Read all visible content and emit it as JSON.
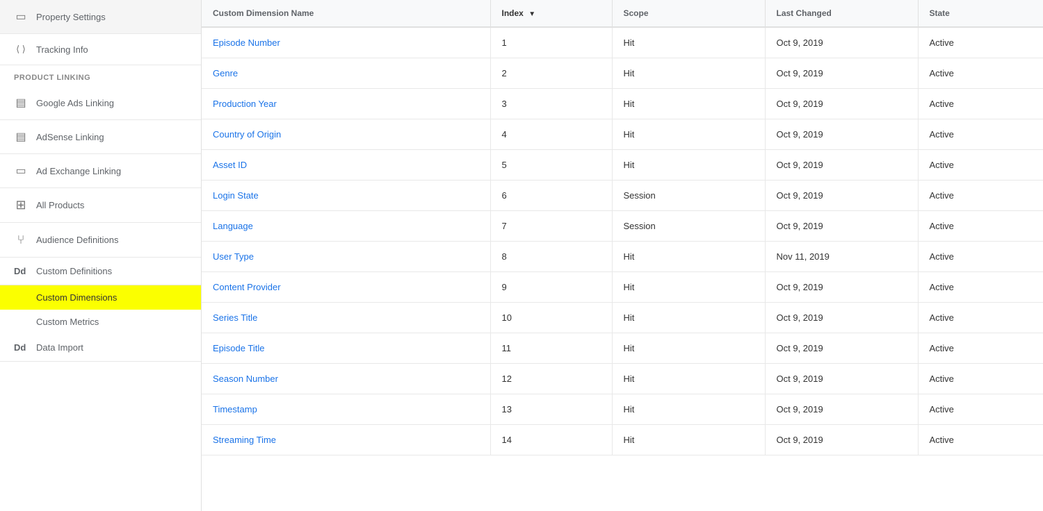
{
  "sidebar": {
    "items": [
      {
        "id": "property-settings",
        "label": "Property Settings",
        "icon": "▭",
        "type": "item"
      },
      {
        "id": "tracking-info",
        "label": "Tracking Info",
        "icon": "⟨⟩",
        "type": "item"
      },
      {
        "id": "product-linking-section",
        "label": "PRODUCT LINKING",
        "type": "section"
      },
      {
        "id": "google-ads-linking",
        "label": "Google Ads Linking",
        "icon": "▤",
        "type": "item"
      },
      {
        "id": "adsense-linking",
        "label": "AdSense Linking",
        "icon": "▤",
        "type": "item"
      },
      {
        "id": "ad-exchange-linking",
        "label": "Ad Exchange Linking",
        "icon": "▭",
        "type": "item"
      },
      {
        "id": "all-products",
        "label": "All Products",
        "icon": "⊞",
        "type": "item"
      },
      {
        "id": "audience-definitions",
        "label": "Audience Definitions",
        "icon": "⑂",
        "type": "item"
      },
      {
        "id": "custom-definitions",
        "label": "Custom Definitions",
        "icon": "Dd",
        "type": "parent"
      },
      {
        "id": "custom-dimensions",
        "label": "Custom Dimensions",
        "type": "subitem",
        "active": true
      },
      {
        "id": "custom-metrics",
        "label": "Custom Metrics",
        "type": "subitem"
      },
      {
        "id": "data-import",
        "label": "Data Import",
        "icon": "Dd",
        "type": "item"
      }
    ]
  },
  "table": {
    "columns": [
      {
        "id": "name",
        "label": "Custom Dimension Name",
        "sortable": false
      },
      {
        "id": "index",
        "label": "Index",
        "sortable": true,
        "sorted": true,
        "sort_dir": "desc"
      },
      {
        "id": "scope",
        "label": "Scope",
        "sortable": false
      },
      {
        "id": "last_changed",
        "label": "Last Changed",
        "sortable": false
      },
      {
        "id": "state",
        "label": "State",
        "sortable": false
      }
    ],
    "rows": [
      {
        "name": "Episode Number",
        "index": "1",
        "scope": "Hit",
        "last_changed": "Oct 9, 2019",
        "state": "Active"
      },
      {
        "name": "Genre",
        "index": "2",
        "scope": "Hit",
        "last_changed": "Oct 9, 2019",
        "state": "Active"
      },
      {
        "name": "Production Year",
        "index": "3",
        "scope": "Hit",
        "last_changed": "Oct 9, 2019",
        "state": "Active"
      },
      {
        "name": "Country of Origin",
        "index": "4",
        "scope": "Hit",
        "last_changed": "Oct 9, 2019",
        "state": "Active"
      },
      {
        "name": "Asset ID",
        "index": "5",
        "scope": "Hit",
        "last_changed": "Oct 9, 2019",
        "state": "Active"
      },
      {
        "name": "Login State",
        "index": "6",
        "scope": "Session",
        "last_changed": "Oct 9, 2019",
        "state": "Active"
      },
      {
        "name": "Language",
        "index": "7",
        "scope": "Session",
        "last_changed": "Oct 9, 2019",
        "state": "Active"
      },
      {
        "name": "User Type",
        "index": "8",
        "scope": "Hit",
        "last_changed": "Nov 11, 2019",
        "state": "Active"
      },
      {
        "name": "Content Provider",
        "index": "9",
        "scope": "Hit",
        "last_changed": "Oct 9, 2019",
        "state": "Active"
      },
      {
        "name": "Series Title",
        "index": "10",
        "scope": "Hit",
        "last_changed": "Oct 9, 2019",
        "state": "Active"
      },
      {
        "name": "Episode Title",
        "index": "11",
        "scope": "Hit",
        "last_changed": "Oct 9, 2019",
        "state": "Active"
      },
      {
        "name": "Season Number",
        "index": "12",
        "scope": "Hit",
        "last_changed": "Oct 9, 2019",
        "state": "Active"
      },
      {
        "name": "Timestamp",
        "index": "13",
        "scope": "Hit",
        "last_changed": "Oct 9, 2019",
        "state": "Active"
      },
      {
        "name": "Streaming Time",
        "index": "14",
        "scope": "Hit",
        "last_changed": "Oct 9, 2019",
        "state": "Active"
      }
    ]
  }
}
